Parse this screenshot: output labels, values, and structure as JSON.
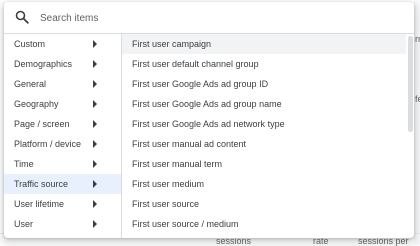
{
  "search": {
    "placeholder": "Search items",
    "value": "",
    "icon": "search-icon"
  },
  "categories": [
    {
      "label": "Custom",
      "selected": false
    },
    {
      "label": "Demographics",
      "selected": false
    },
    {
      "label": "General",
      "selected": false
    },
    {
      "label": "Geography",
      "selected": false
    },
    {
      "label": "Page / screen",
      "selected": false
    },
    {
      "label": "Platform / device",
      "selected": false
    },
    {
      "label": "Time",
      "selected": false
    },
    {
      "label": "Traffic source",
      "selected": true
    },
    {
      "label": "User lifetime",
      "selected": false
    },
    {
      "label": "User",
      "selected": false
    }
  ],
  "items": [
    {
      "label": "First user campaign",
      "hovered": true
    },
    {
      "label": "First user default channel group"
    },
    {
      "label": "First user Google Ads ad group ID"
    },
    {
      "label": "First user Google Ads ad group name"
    },
    {
      "label": "First user Google Ads ad network type"
    },
    {
      "label": "First user manual ad content"
    },
    {
      "label": "First user manual term"
    },
    {
      "label": "First user medium"
    },
    {
      "label": "First user source"
    },
    {
      "label": "First user source / medium"
    }
  ],
  "background": {
    "fragments": [
      "rn",
      "fe"
    ],
    "footer": [
      "sessions",
      "rate",
      "sessions per"
    ]
  },
  "colors": {
    "selected_bg": "#e8f0fe",
    "hover_bg": "#f1f3f4",
    "text": "#3c4043",
    "divider": "#dadce0"
  }
}
